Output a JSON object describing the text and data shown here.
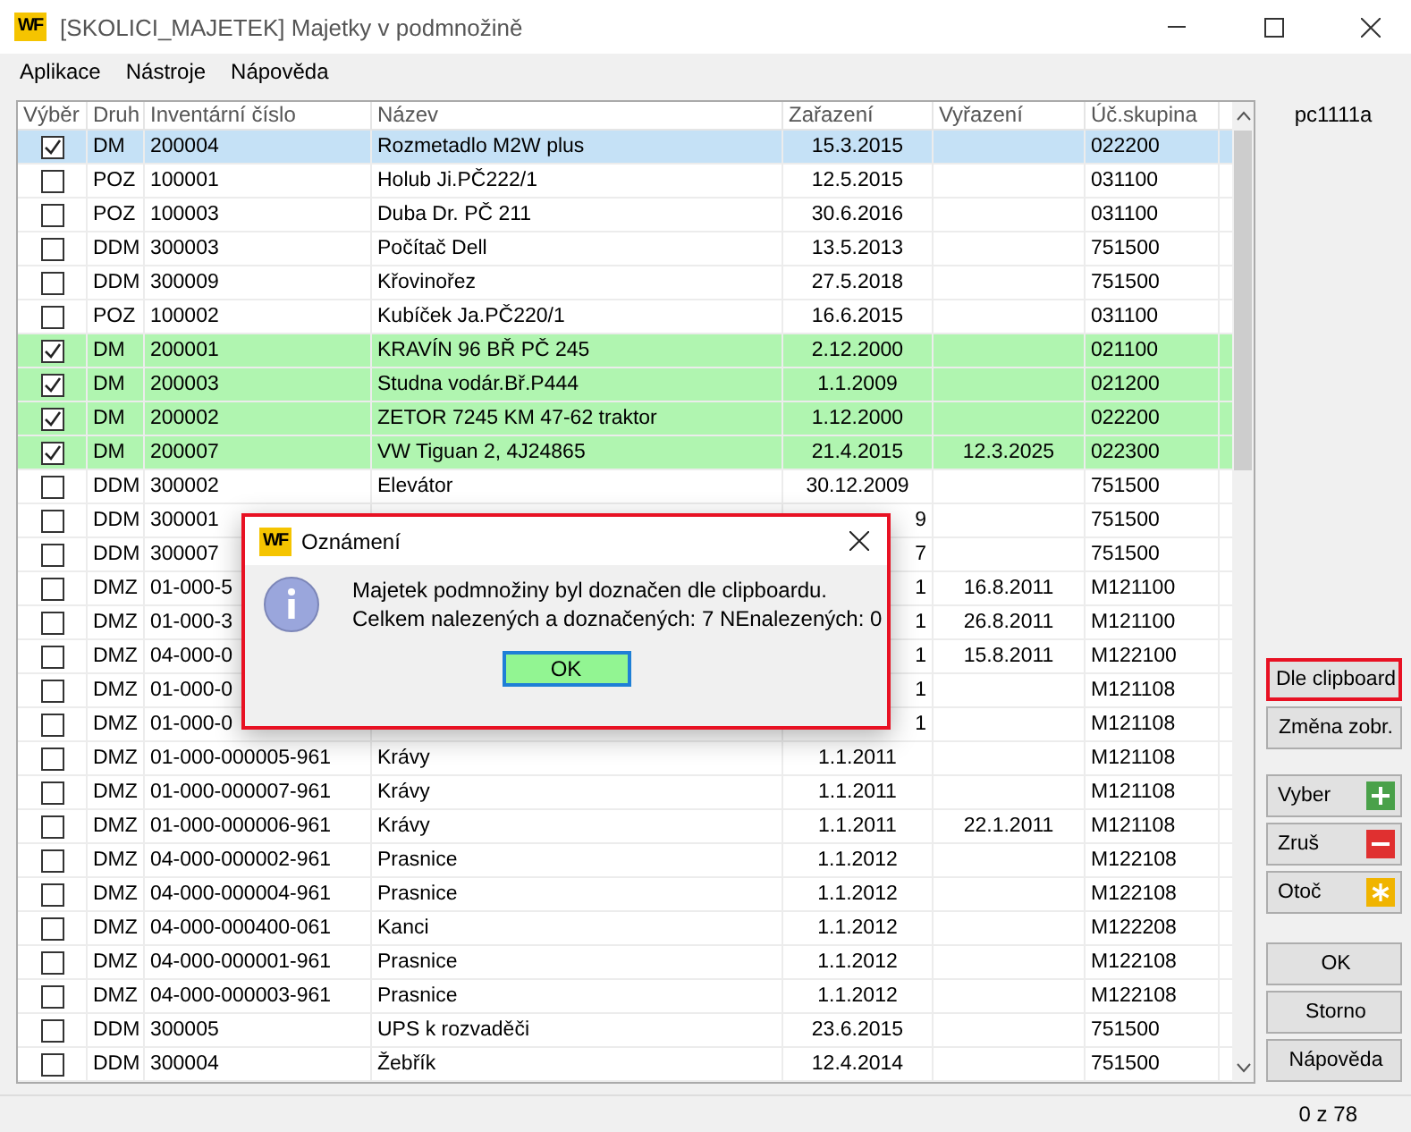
{
  "window": {
    "logo": "WF",
    "title": "[SKOLICI_MAJETEK] Majetky v podmnožině"
  },
  "menu": [
    "Aplikace",
    "Nástroje",
    "Nápověda"
  ],
  "table": {
    "select_column": "Výběr",
    "columns": [
      "Druh",
      "Inventární číslo",
      "Název",
      "Zařazení",
      "Vyřazení",
      "Úč.skupina"
    ],
    "rows": [
      {
        "checked": true,
        "selected": true,
        "matched": false,
        "obscured": false,
        "cells": [
          "DM",
          "200004",
          "Rozmetadlo M2W plus",
          "15.3.2015",
          "",
          "022200"
        ]
      },
      {
        "checked": false,
        "selected": false,
        "matched": false,
        "obscured": false,
        "cells": [
          "POZ",
          "100001",
          "Holub Ji.PČ222/1",
          "12.5.2015",
          "",
          "031100"
        ]
      },
      {
        "checked": false,
        "selected": false,
        "matched": false,
        "obscured": false,
        "cells": [
          "POZ",
          "100003",
          "Duba Dr. PČ 211",
          "30.6.2016",
          "",
          "031100"
        ]
      },
      {
        "checked": false,
        "selected": false,
        "matched": false,
        "obscured": false,
        "cells": [
          "DDM",
          "300003",
          "Počítač Dell",
          "13.5.2013",
          "",
          "751500"
        ]
      },
      {
        "checked": false,
        "selected": false,
        "matched": false,
        "obscured": false,
        "cells": [
          "DDM",
          "300009",
          "Křovinořez",
          "27.5.2018",
          "",
          "751500"
        ]
      },
      {
        "checked": false,
        "selected": false,
        "matched": false,
        "obscured": false,
        "cells": [
          "POZ",
          "100002",
          "Kubíček Ja.PČ220/1",
          "16.6.2015",
          "",
          "031100"
        ]
      },
      {
        "checked": true,
        "selected": false,
        "matched": true,
        "obscured": false,
        "cells": [
          "DM",
          "200001",
          "KRAVÍN 96 BŘ PČ 245",
          "2.12.2000",
          "",
          "021100"
        ]
      },
      {
        "checked": true,
        "selected": false,
        "matched": true,
        "obscured": false,
        "cells": [
          "DM",
          "200003",
          "Studna vodár.Bř.P444",
          "1.1.2009",
          "",
          "021200"
        ]
      },
      {
        "checked": true,
        "selected": false,
        "matched": true,
        "obscured": false,
        "cells": [
          "DM",
          "200002",
          "ZETOR 7245 KM 47-62 traktor",
          "1.12.2000",
          "",
          "022200"
        ]
      },
      {
        "checked": true,
        "selected": false,
        "matched": true,
        "obscured": false,
        "cells": [
          "DM",
          "200007",
          "VW Tiguan 2, 4J24865",
          "21.4.2015",
          "12.3.2025",
          "022300"
        ]
      },
      {
        "checked": false,
        "selected": false,
        "matched": false,
        "obscured": false,
        "cells": [
          "DDM",
          "300002",
          "Elevátor",
          "30.12.2009",
          "",
          "751500"
        ]
      },
      {
        "checked": false,
        "selected": false,
        "matched": false,
        "obscured": true,
        "cells": [
          "DDM",
          "300001",
          "",
          "9",
          "",
          "751500"
        ]
      },
      {
        "checked": false,
        "selected": false,
        "matched": false,
        "obscured": true,
        "cells": [
          "DDM",
          "300007",
          "",
          "7",
          "",
          "751500"
        ]
      },
      {
        "checked": false,
        "selected": false,
        "matched": false,
        "obscured": true,
        "cells": [
          "DMZ",
          "01-000-5",
          "",
          "1",
          "16.8.2011",
          "M121100"
        ]
      },
      {
        "checked": false,
        "selected": false,
        "matched": false,
        "obscured": true,
        "cells": [
          "DMZ",
          "01-000-3",
          "",
          "1",
          "26.8.2011",
          "M121100"
        ]
      },
      {
        "checked": false,
        "selected": false,
        "matched": false,
        "obscured": true,
        "cells": [
          "DMZ",
          "04-000-0",
          "",
          "1",
          "15.8.2011",
          "M122100"
        ]
      },
      {
        "checked": false,
        "selected": false,
        "matched": false,
        "obscured": true,
        "cells": [
          "DMZ",
          "01-000-0",
          "",
          "1",
          "",
          "M121108"
        ]
      },
      {
        "checked": false,
        "selected": false,
        "matched": false,
        "obscured": true,
        "cells": [
          "DMZ",
          "01-000-0",
          "",
          "1",
          "",
          "M121108"
        ]
      },
      {
        "checked": false,
        "selected": false,
        "matched": false,
        "obscured": false,
        "cells": [
          "DMZ",
          "01-000-000005-961",
          "Krávy",
          "1.1.2011",
          "",
          "M121108"
        ]
      },
      {
        "checked": false,
        "selected": false,
        "matched": false,
        "obscured": false,
        "cells": [
          "DMZ",
          "01-000-000007-961",
          "Krávy",
          "1.1.2011",
          "",
          "M121108"
        ]
      },
      {
        "checked": false,
        "selected": false,
        "matched": false,
        "obscured": false,
        "cells": [
          "DMZ",
          "01-000-000006-961",
          "Krávy",
          "1.1.2011",
          "22.1.2011",
          "M121108"
        ]
      },
      {
        "checked": false,
        "selected": false,
        "matched": false,
        "obscured": false,
        "cells": [
          "DMZ",
          "04-000-000002-961",
          "Prasnice",
          "1.1.2012",
          "",
          "M122108"
        ]
      },
      {
        "checked": false,
        "selected": false,
        "matched": false,
        "obscured": false,
        "cells": [
          "DMZ",
          "04-000-000004-961",
          "Prasnice",
          "1.1.2012",
          "",
          "M122108"
        ]
      },
      {
        "checked": false,
        "selected": false,
        "matched": false,
        "obscured": false,
        "cells": [
          "DMZ",
          "04-000-000400-061",
          "Kanci",
          "1.1.2012",
          "",
          "M122208"
        ]
      },
      {
        "checked": false,
        "selected": false,
        "matched": false,
        "obscured": false,
        "cells": [
          "DMZ",
          "04-000-000001-961",
          "Prasnice",
          "1.1.2012",
          "",
          "M122108"
        ]
      },
      {
        "checked": false,
        "selected": false,
        "matched": false,
        "obscured": false,
        "cells": [
          "DMZ",
          "04-000-000003-961",
          "Prasnice",
          "1.1.2012",
          "",
          "M122108"
        ]
      },
      {
        "checked": false,
        "selected": false,
        "matched": false,
        "obscured": false,
        "cells": [
          "DDM",
          "300005",
          "UPS k rozvaděči",
          "23.6.2015",
          "",
          "751500"
        ]
      },
      {
        "checked": false,
        "selected": false,
        "matched": false,
        "obscured": false,
        "cells": [
          "DDM",
          "300004",
          "Žebřík",
          "12.4.2014",
          "",
          "751500"
        ]
      }
    ]
  },
  "side_panel": {
    "user": "pc1111a",
    "buttons": [
      {
        "label": "Dle clipboard",
        "kind": "plain",
        "highlighted": true
      },
      {
        "label": "Změna zobr.",
        "kind": "plain",
        "highlighted": false
      },
      {
        "label": "Vyber",
        "kind": "add",
        "highlighted": false
      },
      {
        "label": "Zruš",
        "kind": "remove",
        "highlighted": false
      },
      {
        "label": "Otoč",
        "kind": "invert",
        "highlighted": false
      },
      {
        "label": "OK",
        "kind": "plain",
        "highlighted": false
      },
      {
        "label": "Storno",
        "kind": "plain",
        "highlighted": false
      },
      {
        "label": "Nápověda",
        "kind": "plain",
        "highlighted": false
      }
    ]
  },
  "status_bar": {
    "count": "0 z 78"
  },
  "dialog": {
    "logo": "WF",
    "title": "Oznámení",
    "lines": [
      "Majetek podmnožiny byl doznačen dle clipboardu.",
      "Celkem nalezených a doznačených: 7 NEnalezených: 0"
    ],
    "button": "OK"
  }
}
